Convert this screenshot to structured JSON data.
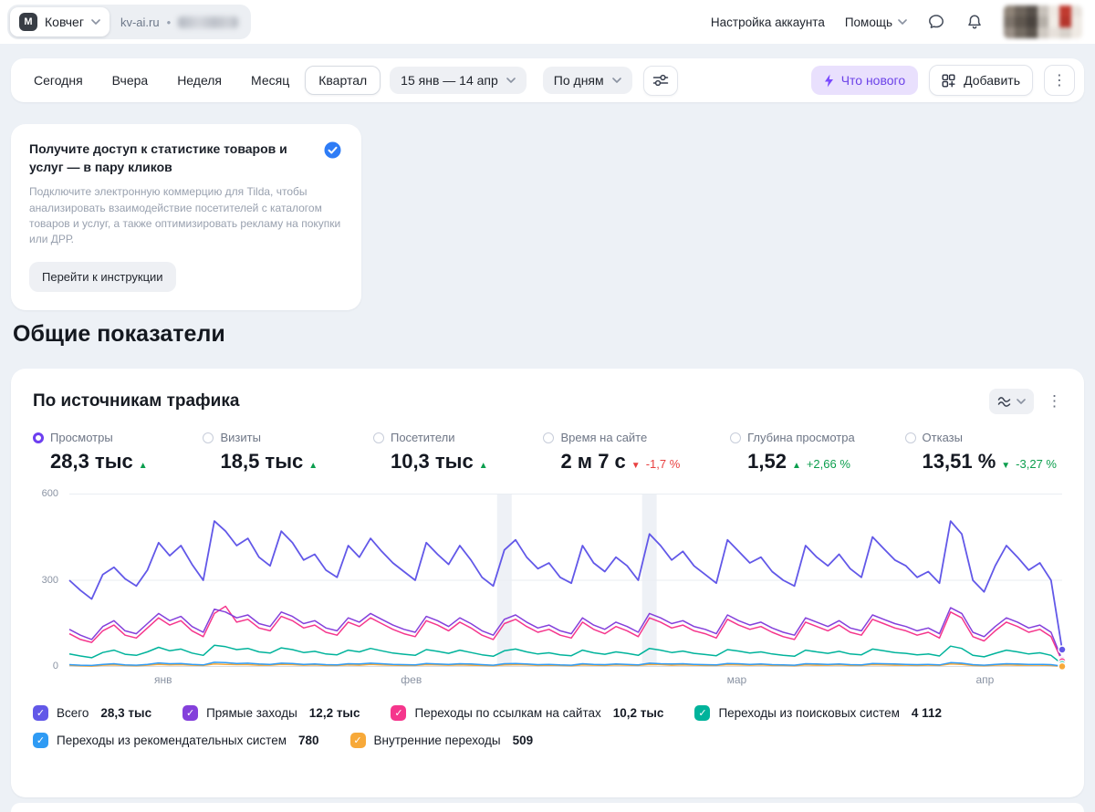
{
  "glyphs": {
    "check": "✓",
    "kebab": "⋮",
    "dot_separator": "•"
  },
  "topbar": {
    "logo_letter": "М",
    "counter_name": "Ковчег",
    "site_domain": "kv-ai.ru",
    "account_settings_label": "Настройка аккаунта",
    "help_label": "Помощь"
  },
  "toolbar": {
    "periods": [
      {
        "label": "Сегодня",
        "selected": false
      },
      {
        "label": "Вчера",
        "selected": false
      },
      {
        "label": "Неделя",
        "selected": false
      },
      {
        "label": "Месяц",
        "selected": false
      },
      {
        "label": "Квартал",
        "selected": true
      }
    ],
    "date_range": "15 янв — 14 апр",
    "grouping": "По дням",
    "whats_new_label": "Что нового",
    "add_label": "Добавить"
  },
  "promo": {
    "title": "Получите доступ к статистике товаров и услуг — в пару кликов",
    "body": "Подключите электронную коммерцию для Tilda, чтобы анализировать взаимодействие посетителей с каталогом товаров и услуг, а также оптимизировать рекламу на покупки или ДРР.",
    "cta": "Перейти к инструкции"
  },
  "section_title": "Общие показатели",
  "widget": {
    "title": "По источникам трафика",
    "metrics": [
      {
        "label": "Просмотры",
        "value": "28,3 тыс",
        "arrow": "▲",
        "arrow_color": "#0b9e4d",
        "delta": "",
        "delta_color": "#0b9e4d",
        "selected": true
      },
      {
        "label": "Визиты",
        "value": "18,5 тыс",
        "arrow": "▲",
        "arrow_color": "#0b9e4d",
        "delta": "",
        "delta_color": "#0b9e4d",
        "selected": false
      },
      {
        "label": "Посетители",
        "value": "10,3 тыс",
        "arrow": "▲",
        "arrow_color": "#0b9e4d",
        "delta": "",
        "delta_color": "#0b9e4d",
        "selected": false
      },
      {
        "label": "Время на сайте",
        "value": "2 м 7 с",
        "arrow": "▼",
        "arrow_color": "#e84040",
        "delta": "-1,7 %",
        "delta_color": "#e84040",
        "selected": false
      },
      {
        "label": "Глубина просмотра",
        "value": "1,52",
        "arrow": "▲",
        "arrow_color": "#0b9e4d",
        "delta": "+2,66 %",
        "delta_color": "#0b9e4d",
        "selected": false
      },
      {
        "label": "Отказы",
        "value": "13,51 %",
        "arrow": "▼",
        "arrow_color": "#0b9e4d",
        "delta": "-3,27 %",
        "delta_color": "#0b9e4d",
        "selected": false
      }
    ]
  },
  "chart_data": {
    "type": "line",
    "title": "По источникам трафика",
    "ylim": [
      0,
      600
    ],
    "yticks": [
      600,
      300,
      0
    ],
    "x_months": [
      {
        "label": "янв",
        "days": 17
      },
      {
        "label": "фев",
        "days": 28
      },
      {
        "label": "мар",
        "days": 31
      },
      {
        "label": "апр",
        "days": 14
      }
    ],
    "holiday_band_indices": [
      39,
      52
    ],
    "series": [
      {
        "name": "Всего",
        "total": "28,3 тыс",
        "color": "#6258e8",
        "values": [
          300,
          265,
          235,
          320,
          345,
          305,
          280,
          335,
          430,
          385,
          420,
          355,
          300,
          505,
          470,
          420,
          445,
          380,
          350,
          470,
          430,
          370,
          390,
          335,
          310,
          420,
          380,
          445,
          400,
          360,
          330,
          300,
          430,
          390,
          355,
          420,
          370,
          310,
          280,
          405,
          440,
          380,
          340,
          360,
          310,
          290,
          420,
          360,
          330,
          380,
          350,
          300,
          460,
          420,
          370,
          400,
          350,
          320,
          290,
          440,
          400,
          360,
          380,
          330,
          300,
          280,
          420,
          380,
          350,
          390,
          340,
          310,
          450,
          410,
          370,
          350,
          310,
          330,
          290,
          505,
          460,
          300,
          260,
          350,
          420,
          380,
          335,
          360,
          300,
          60
        ]
      },
      {
        "name": "Прямые заходы",
        "total": "12,2 тыс",
        "color": "#8440db",
        "values": [
          130,
          110,
          95,
          140,
          160,
          125,
          115,
          150,
          185,
          160,
          175,
          140,
          120,
          200,
          190,
          170,
          180,
          150,
          140,
          190,
          175,
          150,
          160,
          135,
          125,
          170,
          155,
          185,
          165,
          145,
          130,
          120,
          175,
          160,
          140,
          170,
          150,
          125,
          110,
          165,
          180,
          155,
          135,
          145,
          125,
          115,
          170,
          145,
          130,
          155,
          140,
          120,
          185,
          170,
          150,
          160,
          140,
          130,
          115,
          180,
          160,
          145,
          155,
          135,
          120,
          110,
          170,
          155,
          140,
          160,
          135,
          125,
          180,
          165,
          150,
          140,
          125,
          135,
          115,
          205,
          185,
          120,
          105,
          140,
          170,
          155,
          135,
          145,
          120,
          25
        ]
      },
      {
        "name": "Переходы по ссылкам на сайтах",
        "total": "10,2 тыс",
        "color": "#f5368c",
        "values": [
          115,
          95,
          85,
          125,
          145,
          110,
          100,
          135,
          170,
          145,
          160,
          125,
          105,
          185,
          210,
          155,
          165,
          135,
          125,
          175,
          160,
          135,
          145,
          120,
          110,
          155,
          140,
          170,
          150,
          130,
          115,
          105,
          160,
          145,
          125,
          155,
          135,
          110,
          95,
          150,
          165,
          140,
          120,
          130,
          110,
          100,
          155,
          130,
          115,
          140,
          125,
          105,
          170,
          155,
          135,
          145,
          125,
          115,
          100,
          165,
          145,
          130,
          140,
          120,
          105,
          95,
          155,
          140,
          125,
          145,
          120,
          110,
          165,
          150,
          135,
          125,
          110,
          120,
          100,
          190,
          170,
          105,
          90,
          125,
          155,
          140,
          120,
          130,
          105,
          20
        ]
      },
      {
        "name": "Переходы из поисковых систем",
        "total": "4 112",
        "color": "#00b39b",
        "values": [
          45,
          38,
          32,
          50,
          58,
          44,
          40,
          52,
          68,
          56,
          62,
          48,
          40,
          75,
          70,
          60,
          64,
          52,
          48,
          66,
          60,
          50,
          54,
          45,
          42,
          58,
          52,
          64,
          56,
          48,
          44,
          40,
          60,
          54,
          47,
          58,
          50,
          42,
          37,
          56,
          62,
          52,
          45,
          49,
          42,
          39,
          58,
          49,
          44,
          52,
          47,
          40,
          64,
          58,
          50,
          55,
          47,
          43,
          39,
          60,
          55,
          48,
          52,
          45,
          40,
          37,
          58,
          52,
          47,
          54,
          45,
          42,
          62,
          56,
          50,
          47,
          42,
          45,
          38,
          72,
          64,
          40,
          35,
          47,
          58,
          52,
          45,
          49,
          40,
          10
        ]
      },
      {
        "name": "Переходы из рекомендательных систем",
        "total": "780",
        "color": "#2f9bf4",
        "values": [
          8,
          6,
          5,
          9,
          11,
          7,
          6,
          9,
          14,
          11,
          12,
          9,
          7,
          16,
          15,
          12,
          13,
          10,
          9,
          13,
          12,
          9,
          10,
          8,
          7,
          11,
          10,
          13,
          11,
          9,
          8,
          7,
          12,
          10,
          9,
          11,
          10,
          8,
          6,
          11,
          12,
          10,
          8,
          9,
          7,
          6,
          11,
          9,
          8,
          10,
          9,
          7,
          13,
          11,
          10,
          11,
          9,
          8,
          7,
          12,
          11,
          9,
          10,
          8,
          7,
          6,
          11,
          10,
          9,
          10,
          8,
          7,
          12,
          11,
          10,
          9,
          8,
          9,
          7,
          15,
          13,
          8,
          6,
          9,
          11,
          10,
          9,
          9,
          8,
          3
        ]
      },
      {
        "name": "Внутренние переходы",
        "total": "509",
        "color": "#f7a939",
        "values": [
          6,
          4,
          3,
          6,
          7,
          5,
          4,
          6,
          9,
          7,
          8,
          6,
          5,
          10,
          9,
          8,
          8,
          6,
          6,
          9,
          8,
          6,
          7,
          5,
          5,
          7,
          6,
          9,
          7,
          6,
          5,
          5,
          8,
          7,
          6,
          7,
          6,
          5,
          4,
          7,
          8,
          7,
          5,
          6,
          5,
          4,
          7,
          6,
          5,
          7,
          6,
          5,
          9,
          8,
          6,
          7,
          6,
          5,
          5,
          8,
          7,
          6,
          7,
          5,
          5,
          4,
          7,
          6,
          6,
          7,
          5,
          5,
          8,
          7,
          6,
          6,
          5,
          6,
          5,
          10,
          9,
          5,
          4,
          6,
          7,
          6,
          6,
          6,
          5,
          2
        ]
      }
    ]
  }
}
